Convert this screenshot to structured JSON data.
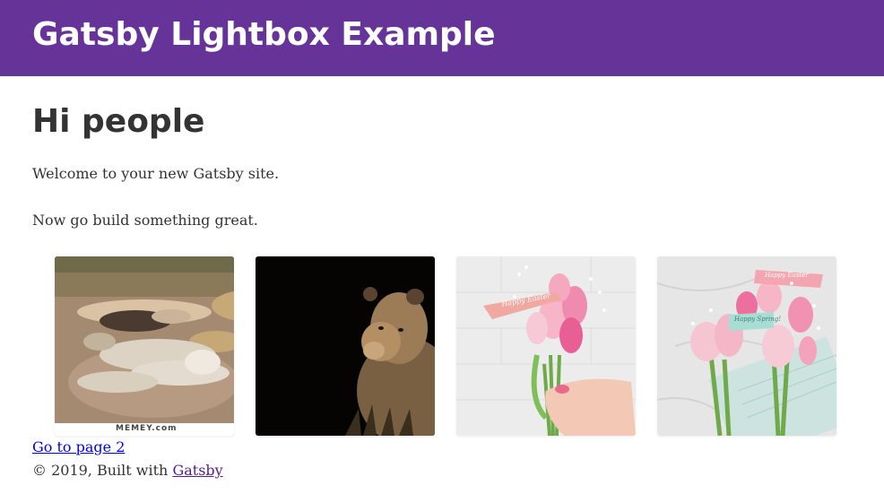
{
  "header": {
    "site_title": "Gatsby Lightbox Example",
    "background_color": "#663399"
  },
  "main": {
    "title": "Hi people",
    "paragraphs": [
      "Welcome to your new Gatsby site.",
      "Now go build something great."
    ],
    "gallery": [
      {
        "name": "woman-lying-with-lions-image",
        "watermark": "MEMEY.com"
      },
      {
        "name": "lioness-dark-background-image"
      },
      {
        "name": "hand-holding-tulips-image",
        "banner_text": "Happy Easter"
      },
      {
        "name": "tulip-bouquets-image",
        "banner_text": "Happy Easter",
        "banner_text_2": "Happy Spring!"
      }
    ],
    "page2_link": "Go to page 2"
  },
  "footer": {
    "copyright": "© 2019, Built with",
    "link": "Gatsby"
  },
  "colors": {
    "text": "#333333",
    "link": "#0000ee",
    "visited_link": "#551a8b",
    "accent": "#663399"
  }
}
